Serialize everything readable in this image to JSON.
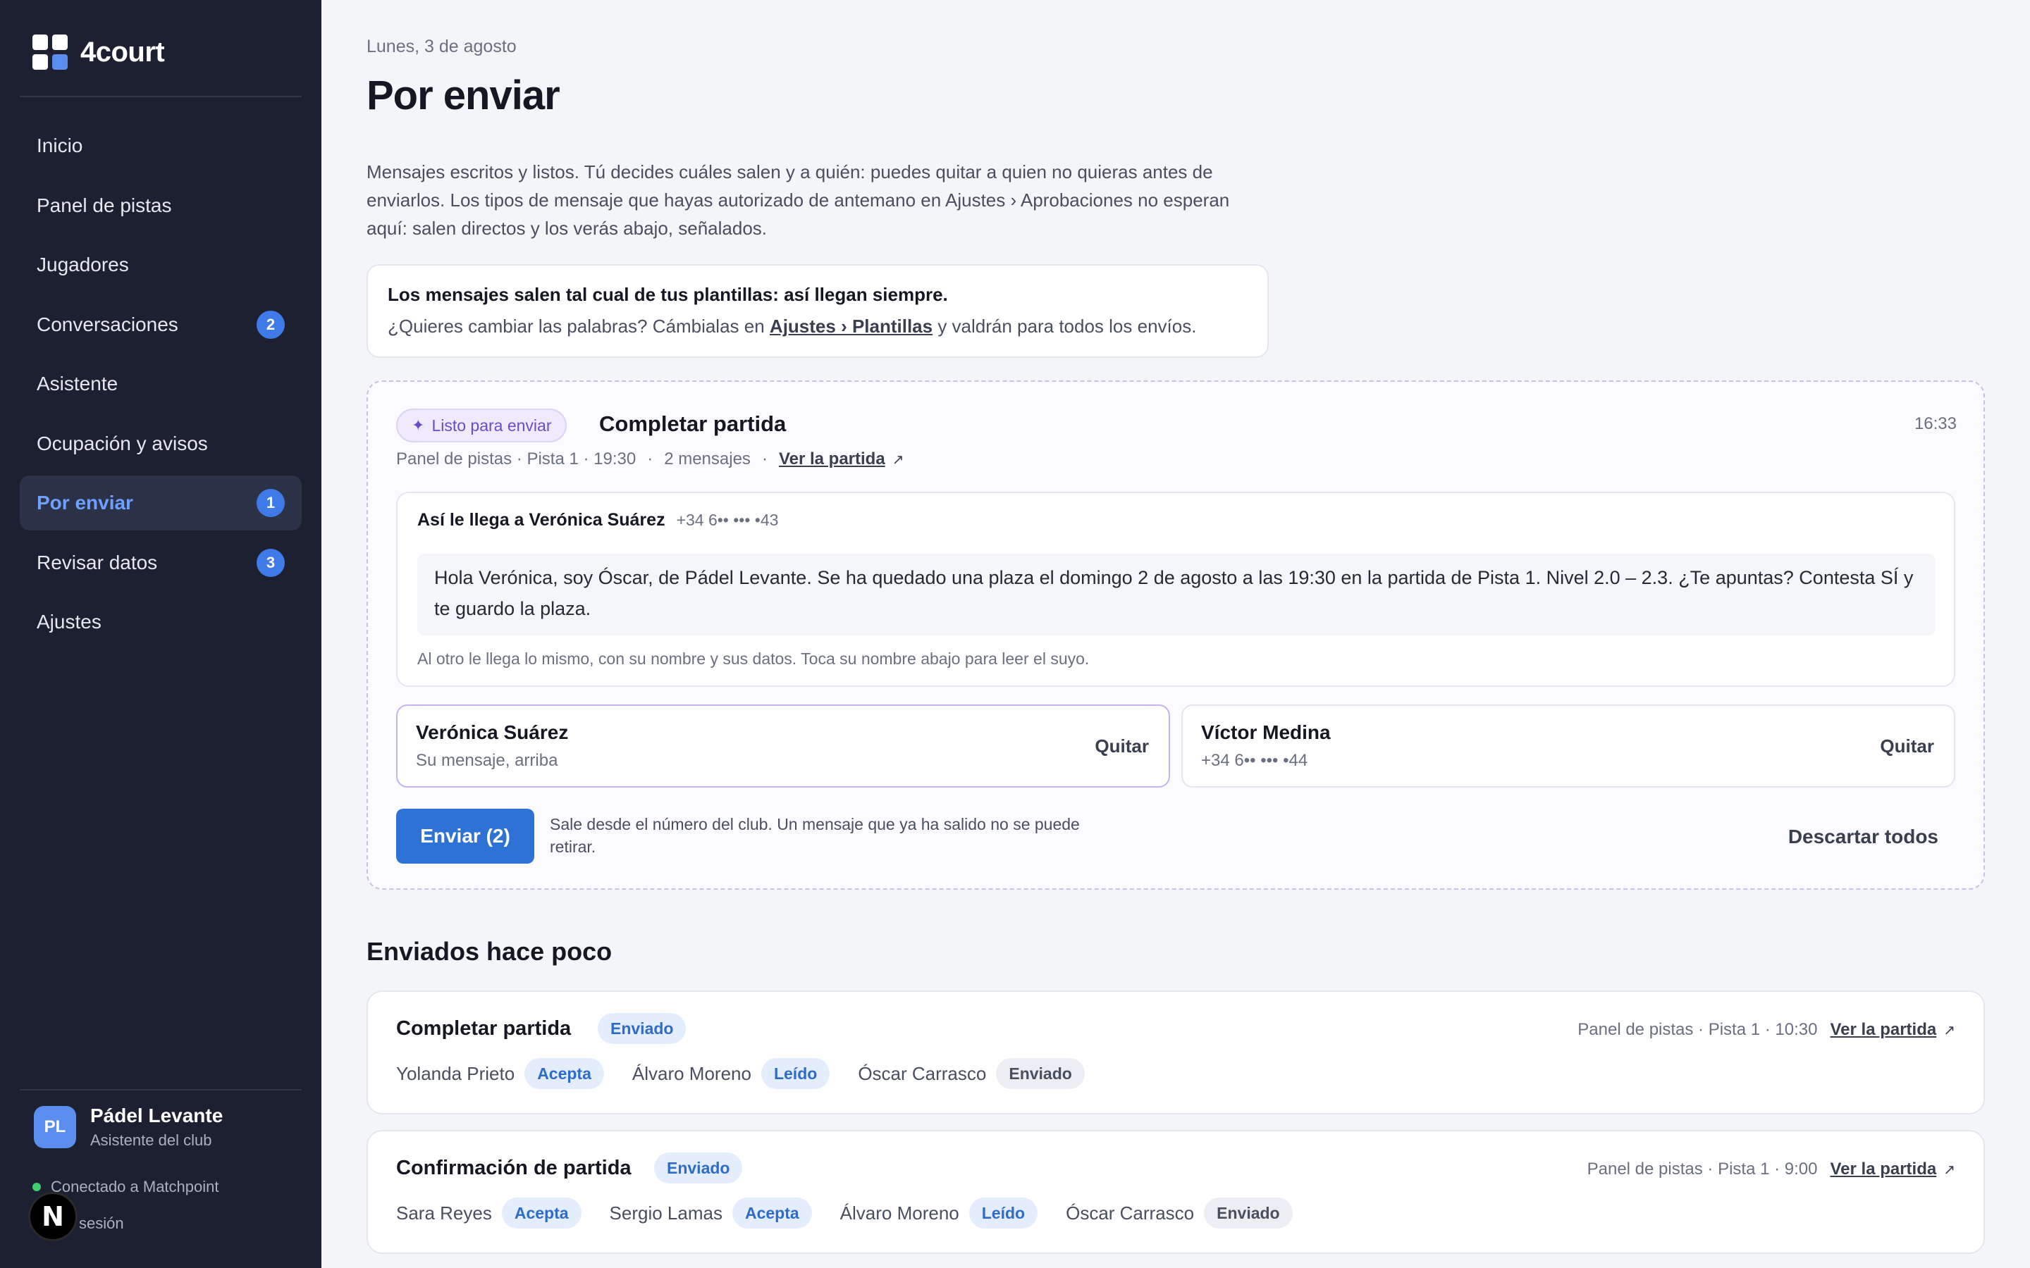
{
  "brand": {
    "name": "4court"
  },
  "sidebar": {
    "items": [
      {
        "label": "Inicio",
        "badge": null,
        "active": false
      },
      {
        "label": "Panel de pistas",
        "badge": null,
        "active": false
      },
      {
        "label": "Jugadores",
        "badge": null,
        "active": false
      },
      {
        "label": "Conversaciones",
        "badge": "2",
        "active": false
      },
      {
        "label": "Asistente",
        "badge": null,
        "active": false
      },
      {
        "label": "Ocupación y avisos",
        "badge": null,
        "active": false
      },
      {
        "label": "Por enviar",
        "badge": "1",
        "active": true
      },
      {
        "label": "Revisar datos",
        "badge": "3",
        "active": false
      },
      {
        "label": "Ajustes",
        "badge": null,
        "active": false
      }
    ],
    "club": {
      "initials": "PL",
      "name": "Pádel Levante",
      "role": "Asistente del club"
    },
    "connection": "Conectado a Matchpoint",
    "logout": "sesión",
    "n_badge": "N"
  },
  "page": {
    "date": "Lunes, 3 de agosto",
    "title": "Por enviar",
    "intro": "Mensajes escritos y listos. Tú decides cuáles salen y a quién: puedes quitar a quien no quieras antes de enviarlos. Los tipos de mensaje que hayas autorizado de antemano en Ajustes › Aprobaciones no esperan aquí: salen directos y los verás abajo, señalados.",
    "note": {
      "bold": "Los mensajes salen tal cual de tus plantillas: así llegan siempre.",
      "text_before": "¿Quieres cambiar las palabras? Cámbialas en ",
      "link": "Ajustes › Plantillas",
      "text_after": " y valdrán para todos los envíos."
    }
  },
  "pending": {
    "status": "Listo para enviar",
    "title": "Completar partida",
    "time": "16:33",
    "meta_source": "Panel de pistas · Pista 1 · 19:30",
    "meta_count": "2 mensajes",
    "meta_link": "Ver la partida",
    "preview_label": "Así le llega a Verónica Suárez",
    "preview_phone": "+34 6•• ••• •43",
    "message": "Hola Verónica, soy Óscar, de Pádel Levante. Se ha quedado una plaza el domingo 2 de agosto a las 19:30 en la partida de Pista 1. Nivel 2.0 – 2.3. ¿Te apuntas? Contesta SÍ y te guardo la plaza.",
    "preview_foot": "Al otro le llega lo mismo, con su nombre y sus datos. Toca su nombre abajo para leer el suyo.",
    "recipients": [
      {
        "name": "Verónica Suárez",
        "sub": "Su mensaje, arriba",
        "remove": "Quitar"
      },
      {
        "name": "Víctor Medina",
        "sub": "+34 6•• ••• •44",
        "remove": "Quitar"
      }
    ],
    "send_label": "Enviar (2)",
    "send_note": "Sale desde el número del club. Un mensaje que ya ha salido no se puede retirar.",
    "discard_label": "Descartar todos"
  },
  "sent_section": {
    "title": "Enviados hace poco",
    "items": [
      {
        "title": "Completar partida",
        "status": "Enviado",
        "source": "Panel de pistas · Pista 1 · 10:30",
        "link": "Ver la partida",
        "people": [
          {
            "name": "Yolanda Prieto",
            "state": "Acepta",
            "tone": "blue"
          },
          {
            "name": "Álvaro Moreno",
            "state": "Leído",
            "tone": "blue"
          },
          {
            "name": "Óscar Carrasco",
            "state": "Enviado",
            "tone": "gray"
          }
        ]
      },
      {
        "title": "Confirmación de partida",
        "status": "Enviado",
        "source": "Panel de pistas · Pista 1 · 9:00",
        "link": "Ver la partida",
        "people": [
          {
            "name": "Sara Reyes",
            "state": "Acepta",
            "tone": "blue"
          },
          {
            "name": "Sergio Lamas",
            "state": "Acepta",
            "tone": "blue"
          },
          {
            "name": "Álvaro Moreno",
            "state": "Leído",
            "tone": "blue"
          },
          {
            "name": "Óscar Carrasco",
            "state": "Enviado",
            "tone": "gray"
          }
        ]
      }
    ]
  },
  "colors": {
    "accent": "#2f72d6",
    "sidebar": "#1c2030",
    "badge": "#3f7be8",
    "ready": "#6b4cc8"
  }
}
